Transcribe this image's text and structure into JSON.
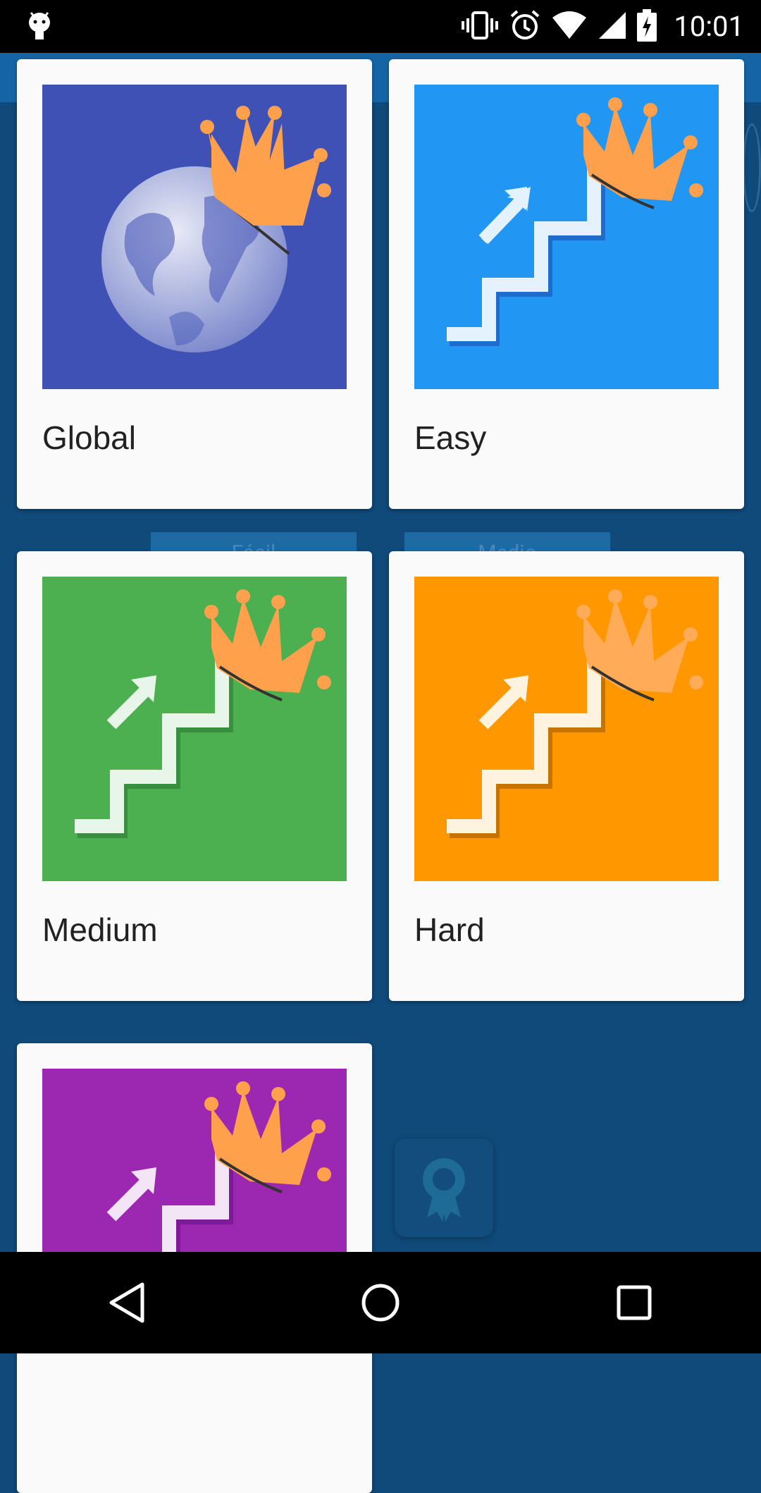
{
  "status_bar": {
    "time": "10:01",
    "icons": [
      "android-debug-icon",
      "vibrate-icon",
      "alarm-icon",
      "wifi-icon",
      "signal-icon",
      "battery-charging-icon"
    ]
  },
  "background": {
    "tabs": [
      "Fácil",
      "Medio"
    ],
    "award_icon": "award-ribbon-icon"
  },
  "cards": [
    {
      "title": "Global",
      "color": "#3f51b5",
      "icon": "globe-crown-icon"
    },
    {
      "title": "Easy",
      "color": "#2196f3",
      "icon": "stairs-crown-icon"
    },
    {
      "title": "Medium",
      "color": "#4caf50",
      "icon": "stairs-crown-icon"
    },
    {
      "title": "Hard",
      "color": "#ff9800",
      "icon": "stairs-crown-icon"
    },
    {
      "title": "",
      "color": "#9c27b0",
      "icon": "stairs-crown-icon"
    }
  ],
  "nav_bar": {
    "buttons": [
      "back-icon",
      "home-icon",
      "recents-icon"
    ]
  }
}
